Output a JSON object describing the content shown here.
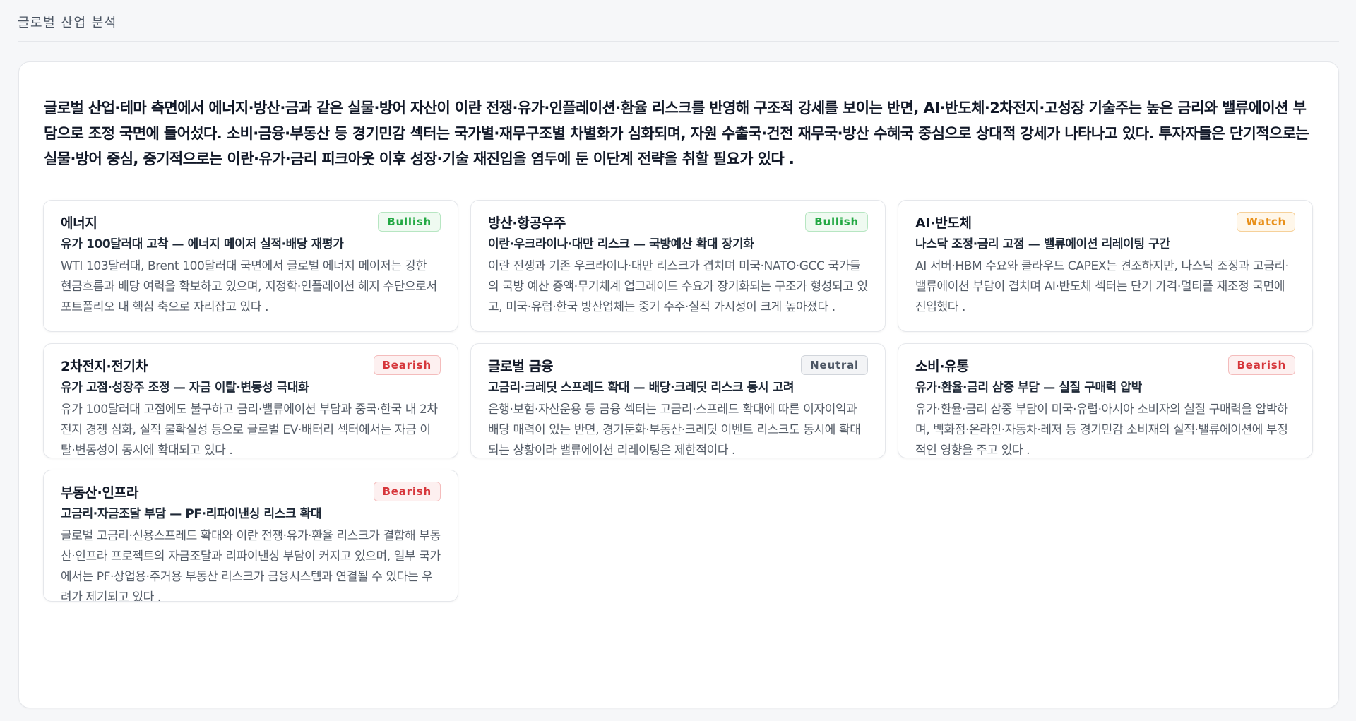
{
  "header": {
    "title": "글로벌 산업 분석"
  },
  "summary": "글로벌 산업·테마 측면에서 에너지·방산·금과 같은 실물·방어 자산이 이란 전쟁·유가·인플레이션·환율 리스크를 반영해 구조적 강세를 보이는 반면, AI·반도체·2차전지·고성장 기술주는 높은 금리와 밸류에이션 부담으로 조정 국면에 들어섰다. 소비·금융·부동산 등 경기민감 섹터는 국가별·재무구조별 차별화가 심화되며, 자원 수출국·건전 재무국·방산 수혜국 중심으로 상대적 강세가 나타나고 있다. 투자자들은 단기적으로는 실물·방어 중심, 중기적으로는 이란·유가·금리 피크아웃 이후 성장·기술 재진입을 염두에 둔 이단계 전략을 취할 필요가 있다 .",
  "badge_colors": {
    "bullish": "#22a843",
    "watch": "#e8901a",
    "bearish": "#d6363b",
    "neutral": "#4b5563"
  },
  "cards": [
    {
      "title": "에너지",
      "badge": "Bullish",
      "subtitle": "유가 100달러대 고착 — 에너지 메이저 실적·배당 재평가",
      "body": "WTI 103달러대, Brent 100달러대 국면에서 글로벌 에너지 메이저는 강한 현금흐름과 배당 여력을 확보하고 있으며, 지정학·인플레이션 헤지 수단으로서 포트폴리오 내 핵심 축으로 자리잡고 있다 ."
    },
    {
      "title": "방산·항공우주",
      "badge": "Bullish",
      "subtitle": "이란·우크라이나·대만 리스크 — 국방예산 확대 장기화",
      "body": "이란 전쟁과 기존 우크라이나·대만 리스크가 겹치며 미국·NATO·GCC 국가들의 국방 예산 증액·무기체계 업그레이드 수요가 장기화되는 구조가 형성되고 있고, 미국·유럽·한국 방산업체는 중기 수주·실적 가시성이 크게 높아졌다 ."
    },
    {
      "title": "AI·반도체",
      "badge": "Watch",
      "subtitle": "나스닥 조정·금리 고점 — 밸류에이션 리레이팅 구간",
      "body": "AI 서버·HBM 수요와 클라우드 CAPEX는 견조하지만, 나스닥 조정과 고금리·밸류에이션 부담이 겹치며 AI·반도체 섹터는 단기 가격·멀티플 재조정 국면에 진입했다 ."
    },
    {
      "title": "2차전지·전기차",
      "badge": "Bearish",
      "subtitle": "유가 고점·성장주 조정 — 자금 이탈·변동성 극대화",
      "body": "유가 100달러대 고점에도 불구하고 금리·밸류에이션 부담과 중국·한국 내 2차전지 경쟁 심화, 실적 불확실성 등으로 글로벌 EV·배터리 섹터에서는 자금 이탈·변동성이 동시에 확대되고 있다 ."
    },
    {
      "title": "글로벌 금융",
      "badge": "Neutral",
      "subtitle": "고금리·크레딧 스프레드 확대 — 배당·크레딧 리스크 동시 고려",
      "body": "은행·보험·자산운용 등 금융 섹터는 고금리·스프레드 확대에 따른 이자이익과 배당 매력이 있는 반면, 경기둔화·부동산·크레딧 이벤트 리스크도 동시에 확대되는 상황이라 밸류에이션 리레이팅은 제한적이다 ."
    },
    {
      "title": "소비·유통",
      "badge": "Bearish",
      "subtitle": "유가·환율·금리 삼중 부담 — 실질 구매력 압박",
      "body": "유가·환율·금리 삼중 부담이 미국·유럽·아시아 소비자의 실질 구매력을 압박하며, 백화점·온라인·자동차·레저 등 경기민감 소비재의 실적·밸류에이션에 부정적인 영향을 주고 있다 ."
    },
    {
      "title": "부동산·인프라",
      "badge": "Bearish",
      "subtitle": "고금리·자금조달 부담 — PF·리파이낸싱 리스크 확대",
      "body": "글로벌 고금리·신용스프레드 확대와 이란 전쟁·유가·환율 리스크가 결합해 부동산·인프라 프로젝트의 자금조달과 리파이낸싱 부담이 커지고 있으며, 일부 국가에서는 PF·상업용·주거용 부동산 리스크가 금융시스템과 연결될 수 있다는 우려가 제기되고 있다 ."
    }
  ]
}
